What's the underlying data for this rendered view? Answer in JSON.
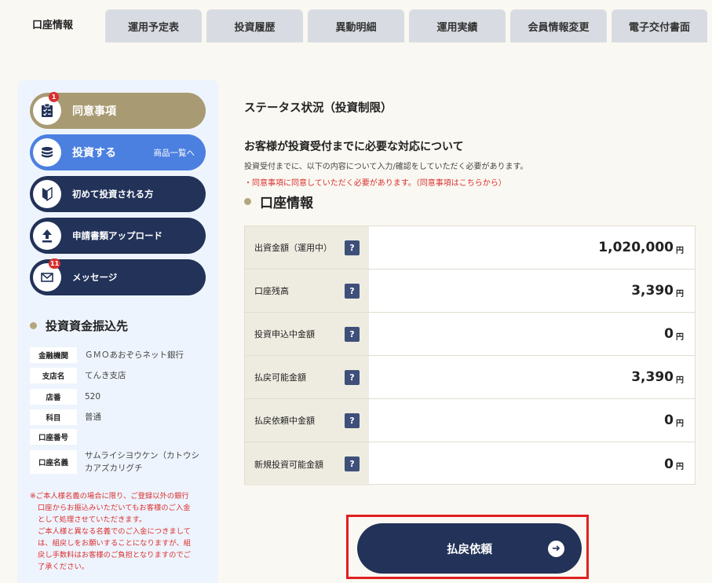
{
  "tabs": [
    {
      "label": "口座情報",
      "active": true
    },
    {
      "label": "運用予定表"
    },
    {
      "label": "投資履歴"
    },
    {
      "label": "異動明細"
    },
    {
      "label": "運用実績"
    },
    {
      "label": "会員情報変更"
    },
    {
      "label": "電子交付書面"
    }
  ],
  "sidebar": {
    "buttons": [
      {
        "label": "同意事項",
        "icon": "checklist-icon",
        "badge": "1",
        "color": "#a89a72"
      },
      {
        "label": "投資する",
        "sub": "商品一覧へ",
        "icon": "coins-icon",
        "color": "#4c80e0"
      },
      {
        "label": "初めて投資される方",
        "icon": "beginner-mark-icon",
        "color": "#223258"
      },
      {
        "label": "申請書類アップロード",
        "icon": "upload-icon",
        "color": "#223258"
      },
      {
        "label": "メッセージ",
        "icon": "mail-icon",
        "badge": "11",
        "color": "#223258"
      }
    ],
    "bank_title": "投資資金振込先",
    "bank": [
      {
        "label": "金融機関",
        "value": "ＧＭＯあおぞらネット銀行"
      },
      {
        "label": "支店名",
        "value": "てんき支店"
      },
      {
        "label": "店番",
        "value": "520"
      },
      {
        "label": "科目",
        "value": "普通"
      },
      {
        "label": "口座番号",
        "value": ""
      },
      {
        "label": "口座名義",
        "value": "サムライシヨウケン（カトウシカアズカリグチ"
      }
    ],
    "note_lines": [
      "※ご本人様名義の場合に限り、ご登録以外の銀行",
      "口座からお振込みいただいてもお客様のご入金",
      "として処理させていただきます。",
      "ご本人様と異なる名義でのご入金につきまして",
      "は、組戻しをお願いすることになりますが、組",
      "戻し手数料はお客様のご負担となりますのでご",
      "了承ください。"
    ]
  },
  "main": {
    "status_title": "ステータス状況（投資制限）",
    "section_title": "お客様が投資受付までに必要な対応について",
    "description": "投資受付までに、以下の内容について入力/確認をしていただく必要があります。",
    "warning": "・同意事項に同意していただく必要があります。（同意事項はこちらから）",
    "account_title": "口座情報",
    "rows": [
      {
        "label": "出資金額（運用中）",
        "value": "1,020,000",
        "unit": "円"
      },
      {
        "label": "口座残高",
        "value": "3,390",
        "unit": "円"
      },
      {
        "label": "投資申込中金額",
        "value": "0",
        "unit": "円"
      },
      {
        "label": "払戻可能金額",
        "value": "3,390",
        "unit": "円"
      },
      {
        "label": "払戻依頼中金額",
        "value": "0",
        "unit": "円"
      },
      {
        "label": "新規投資可能金額",
        "value": "0",
        "unit": "円"
      }
    ],
    "help_label": "?",
    "withdraw_button": "払戻依頼"
  }
}
